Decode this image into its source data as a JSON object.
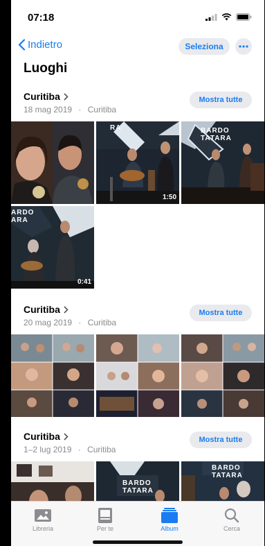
{
  "status": {
    "time": "07:18"
  },
  "nav": {
    "back_label": "Indietro",
    "select_label": "Seleziona"
  },
  "page": {
    "title": "Luoghi"
  },
  "sections": [
    {
      "name": "Curitiba",
      "date": "18 mag 2019",
      "place": "Curitiba",
      "show_all": "Mostra tutte",
      "durations": [
        "1:50",
        "0:41"
      ]
    },
    {
      "name": "Curitiba",
      "date": "20 mag 2019",
      "place": "Curitiba",
      "show_all": "Mostra tutte"
    },
    {
      "name": "Curitiba",
      "date": "1–2 lug 2019",
      "place": "Curitiba",
      "show_all": "Mostra tutte"
    }
  ],
  "sign_text": {
    "line1": "BARDO",
    "line2": "TATARA",
    "short": "RA",
    "side1": "ARDO",
    "side2": "ARA"
  },
  "separator": "·",
  "tabs": [
    {
      "label": "Libreria",
      "icon": "photos-icon"
    },
    {
      "label": "Per te",
      "icon": "for-you-icon"
    },
    {
      "label": "Album",
      "icon": "album-icon"
    },
    {
      "label": "Cerca",
      "icon": "search-icon"
    }
  ],
  "colors": {
    "accent": "#1a7cf0",
    "pill_bg": "#e9eaee",
    "secondary_text": "#8a8a8e"
  }
}
